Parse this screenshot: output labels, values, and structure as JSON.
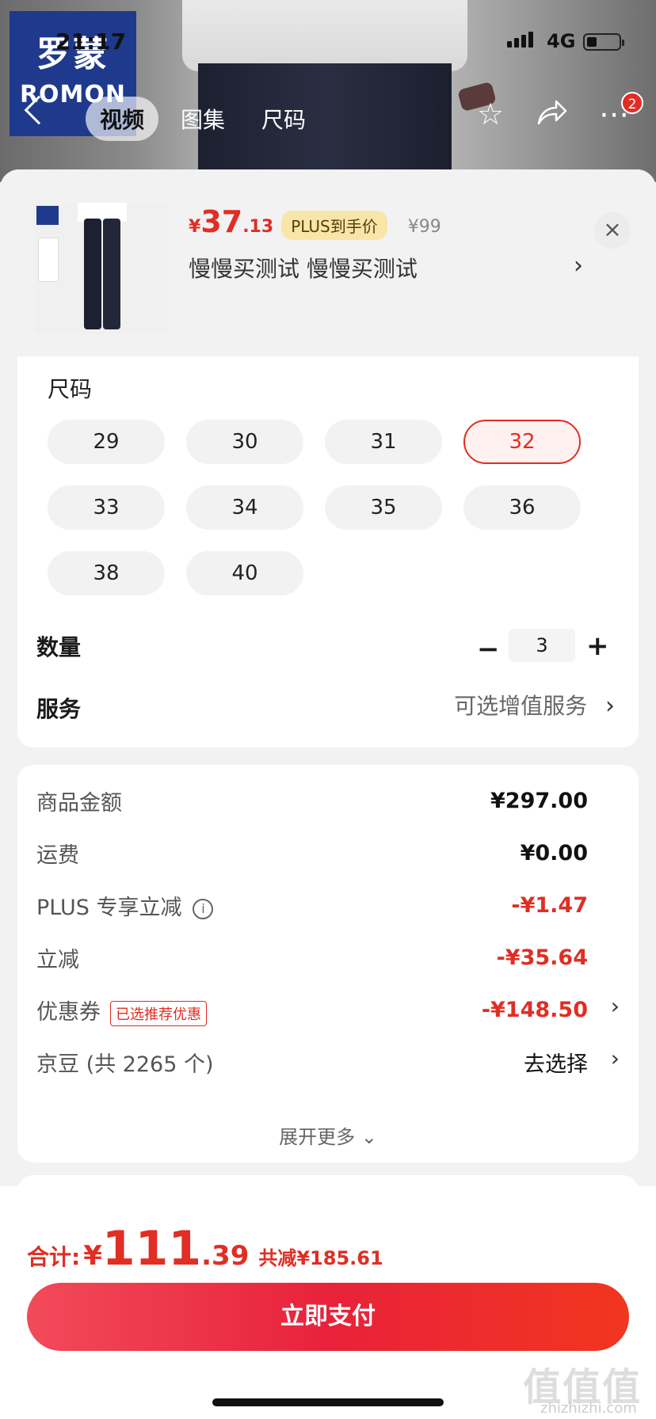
{
  "status_bar": {
    "time": "21:17",
    "network": "4G"
  },
  "brand": {
    "cn": "罗蒙",
    "en": "ROMON"
  },
  "nav": {
    "tabs": [
      {
        "label": "视频",
        "active": true
      },
      {
        "label": "图集",
        "active": false
      },
      {
        "label": "尺码",
        "active": false
      }
    ],
    "badge_count": "2",
    "icons": [
      "back-icon",
      "star-icon",
      "share-icon",
      "more-icon"
    ]
  },
  "product": {
    "currency": "¥",
    "price_int": "37",
    "price_dec": ".13",
    "plus_tag": "PLUS到手价",
    "original_price": "¥99",
    "name": "慢慢买测试  慢慢买测试",
    "chevron": "›",
    "close": "×"
  },
  "size": {
    "title": "尺码",
    "options": [
      "29",
      "30",
      "31",
      "32",
      "33",
      "34",
      "35",
      "36",
      "38",
      "40"
    ],
    "selected": "32"
  },
  "quantity": {
    "label": "数量",
    "value": "3",
    "minus": "−",
    "plus": "+"
  },
  "service": {
    "label": "服务",
    "value": "可选增值服务",
    "chevron": "›"
  },
  "summary": {
    "rows": [
      {
        "label": "商品金额",
        "value": "¥297.00",
        "red": false
      },
      {
        "label": "运费",
        "value": "¥0.00",
        "red": false
      },
      {
        "label": "PLUS 专享立减",
        "value": "-¥1.47",
        "red": true
      },
      {
        "label": "立减",
        "value": "-¥35.64",
        "red": true
      },
      {
        "label": "优惠券",
        "value": "-¥148.50",
        "red": true
      },
      {
        "label": "京豆 (共 2265 个)",
        "value": "去选择",
        "red": false
      }
    ],
    "coupon_tag": "已选推荐优惠",
    "info_icon": "i",
    "expand": "展开更多 ⌄"
  },
  "footer": {
    "total_label": "合计:",
    "currency": "¥",
    "total_int": "111",
    "total_dec": ".39",
    "saved": "共减¥185.61",
    "pay_button": "立即支付"
  },
  "watermark": {
    "main": "值值值",
    "sub": "zhizhizhi.com"
  },
  "colors": {
    "accent": "#e02e24",
    "plus_tag_bg": "#f8e5a8",
    "brand_blue": "#1f3a8c"
  }
}
